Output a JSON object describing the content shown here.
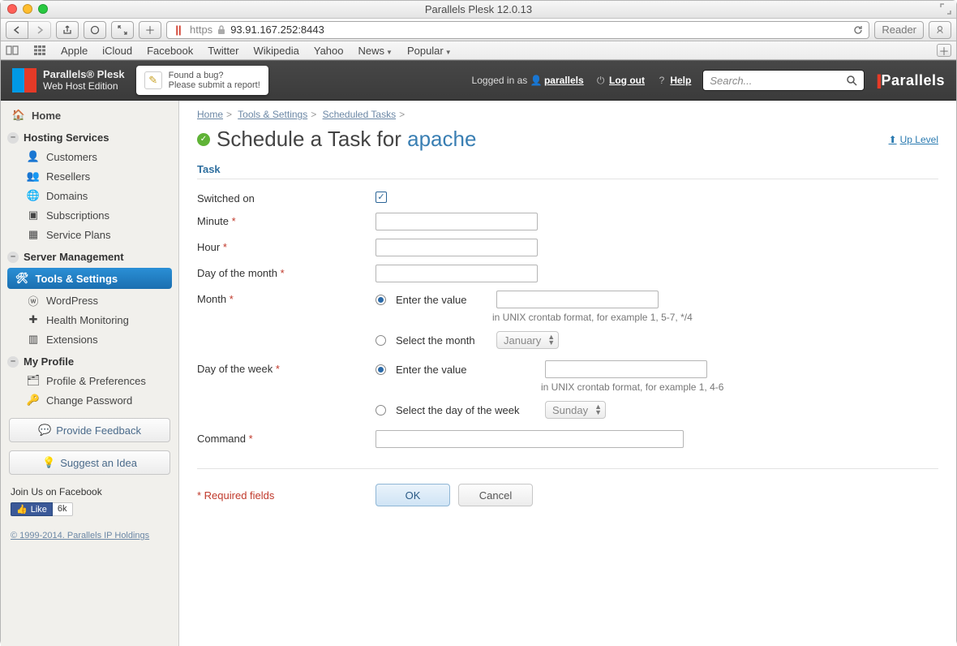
{
  "window": {
    "title": "Parallels Plesk 12.0.13"
  },
  "browser": {
    "scheme": "https",
    "address": "93.91.167.252:8443",
    "reader": "Reader",
    "bookmarks": [
      "Apple",
      "iCloud",
      "Facebook",
      "Twitter",
      "Wikipedia",
      "Yahoo",
      "News",
      "Popular"
    ],
    "menus": [
      "News",
      "Popular"
    ]
  },
  "brand": {
    "product_top": "Parallels® Plesk",
    "product_bottom": "Web Host Edition",
    "parallels": "Parallels"
  },
  "bug_report": {
    "line1": "Found a bug?",
    "line2": "Please submit a report!"
  },
  "header": {
    "logged_in_as": "Logged in as",
    "username": "parallels",
    "logout": "Log out",
    "help": "Help",
    "search_placeholder": "Search..."
  },
  "sidebar": {
    "home": "Home",
    "hosting_head": "Hosting Services",
    "hosting": [
      "Customers",
      "Resellers",
      "Domains",
      "Subscriptions",
      "Service Plans"
    ],
    "server_head": "Server Management",
    "server": [
      "Tools & Settings",
      "WordPress",
      "Health Monitoring",
      "Extensions"
    ],
    "server_active": "Tools & Settings",
    "profile_head": "My Profile",
    "profile": [
      "Profile & Preferences",
      "Change Password"
    ],
    "feedback_btn": "Provide Feedback",
    "suggest_btn": "Suggest an Idea",
    "fb_head": "Join Us on Facebook",
    "fb_like": "Like",
    "fb_count": "6k",
    "copyright": "© 1999-2014. Parallels IP Holdings"
  },
  "breadcrumbs": [
    "Home",
    "Tools & Settings",
    "Scheduled Tasks"
  ],
  "page": {
    "title_prefix": "Schedule a Task for ",
    "title_user": "apache",
    "up_level": "Up Level",
    "section": "Task",
    "fields": {
      "switched_on": "Switched on",
      "minute": "Minute",
      "hour": "Hour",
      "dom": "Day of the month",
      "month": "Month",
      "dow": "Day of the week",
      "command": "Command"
    },
    "month_opts": {
      "enter_value": "Enter the value",
      "hint": "in UNIX crontab format, for example 1, 5-7, */4",
      "select_month": "Select the month",
      "month_value": "January"
    },
    "dow_opts": {
      "enter_value": "Enter the value",
      "hint": "in UNIX crontab format, for example 1, 4-6",
      "select_dow": "Select the day of the week",
      "dow_value": "Sunday"
    },
    "required_note": "* Required fields",
    "ok": "OK",
    "cancel": "Cancel"
  }
}
